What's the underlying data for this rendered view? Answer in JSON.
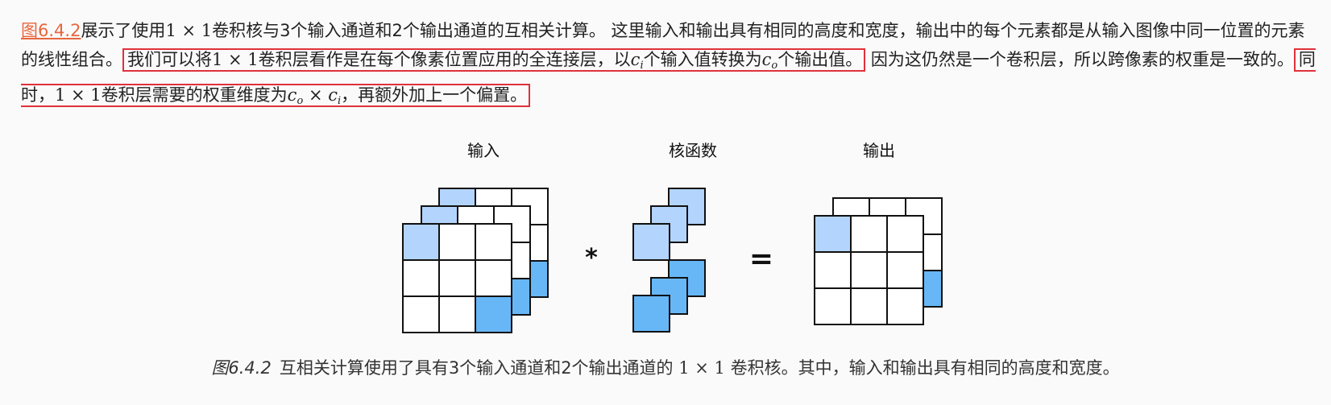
{
  "paragraph": {
    "fig_link": "图6.4.2",
    "seg1": "展示了使用",
    "m1": "1 × 1",
    "seg2": "卷积核与3个输入通道和2个输出通道的互相关计算。 这里输入和输出具有相同的高度和宽度，输出中的每个元素都是从输入图像中同一位置的元素的线性组合。",
    "hl1_a": "我们可以将",
    "hl1_m": "1 × 1",
    "hl1_b": "卷积层看作是在每个像素位置应用的全连接层，以",
    "hl1_ci": "c",
    "hl1_ci_sub": "i",
    "hl1_c": "个输入值转换为",
    "hl1_co": "c",
    "hl1_co_sub": "o",
    "hl1_d": "个输出值。",
    "seg3": " 因为这仍然是一个卷积层，所以跨像素的权重是一致的。",
    "hl2_a": "同时，",
    "hl2_m": "1 × 1",
    "hl2_b": "卷积层需要的权重维度为",
    "hl2_co": "c",
    "hl2_co_sub": "o",
    "hl2_times": " × ",
    "hl2_ci": "c",
    "hl2_ci_sub": "i",
    "hl2_c": "，再额外加上一个偏置。"
  },
  "figure": {
    "label_input": "输入",
    "label_kernel": "核函数",
    "label_output": "输出",
    "op_conv": "*",
    "op_eq": "=",
    "colors": {
      "light_blue": "#b3d4fc",
      "dark_blue": "#67b7f7",
      "white": "#ffffff",
      "stroke": "#111111",
      "highlight_border": "#e0313b",
      "link": "#e8663d"
    }
  },
  "caption": {
    "num": "图6.4.2",
    "text_a": "互相关计算使用了具有3个输入通道和2个输出通道的 ",
    "math": "1 × 1",
    "text_b": " 卷积核。其中，输入和输出具有相同的高度和宽度。"
  }
}
